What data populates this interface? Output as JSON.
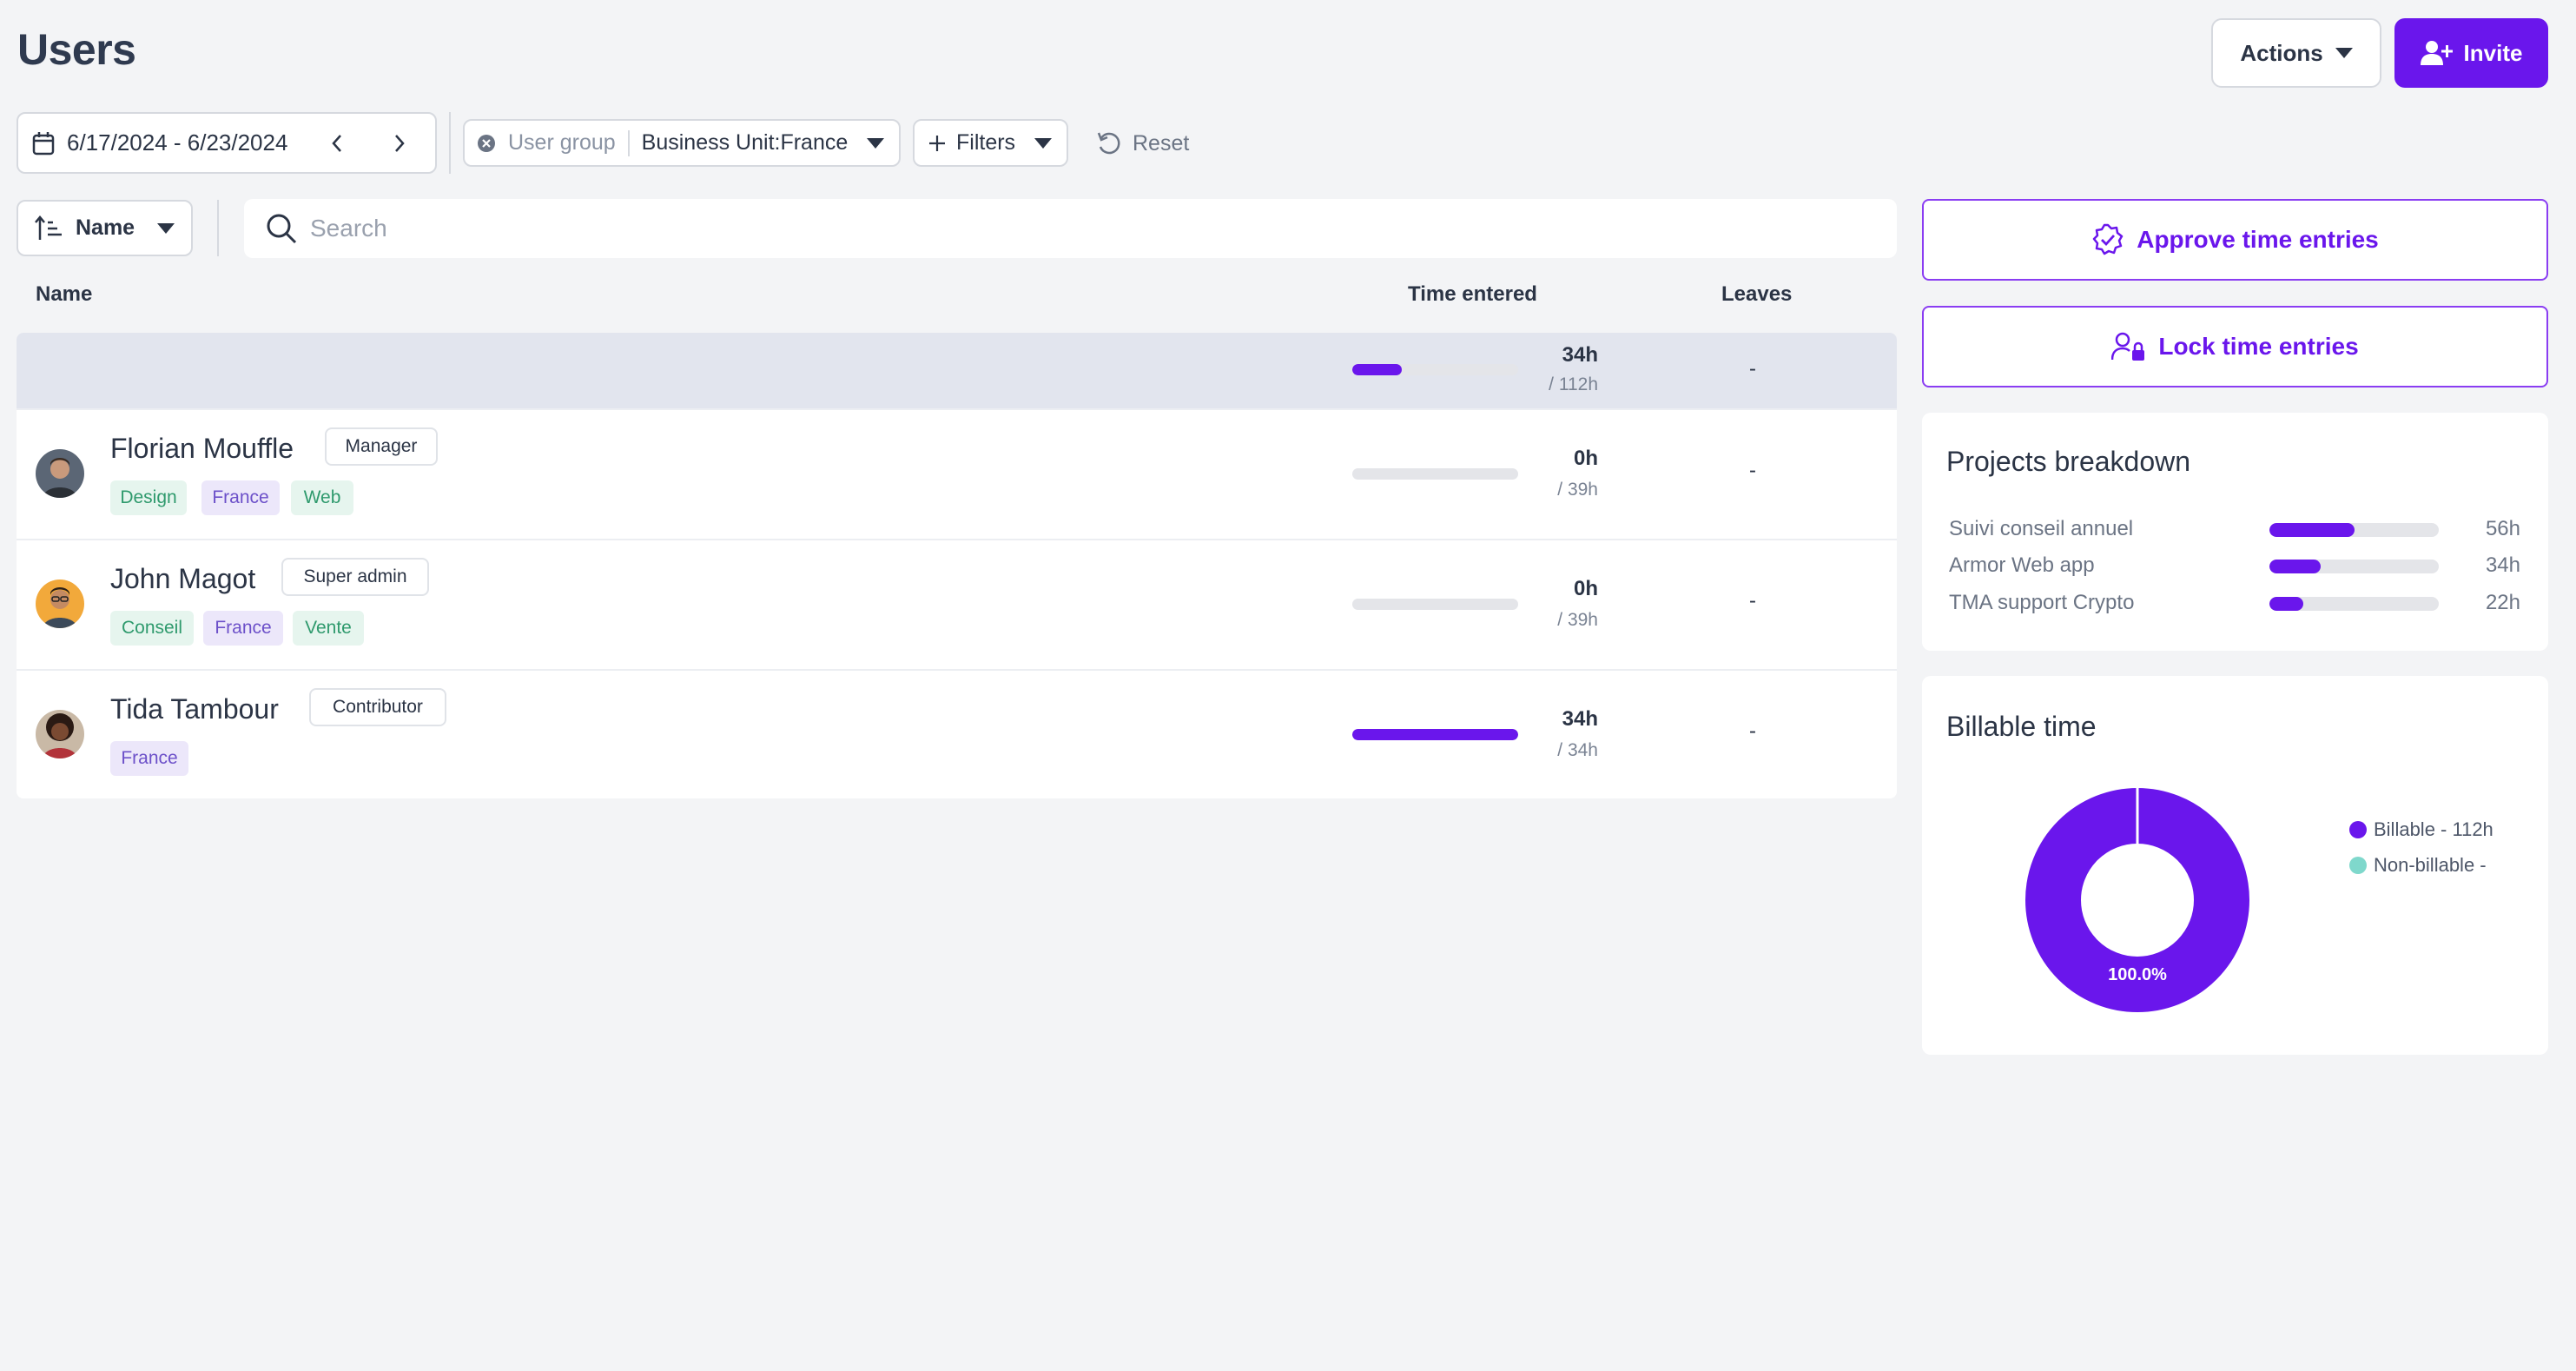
{
  "page": {
    "title": "Users"
  },
  "header": {
    "actions_label": "Actions",
    "invite_label": "Invite"
  },
  "filters": {
    "date_range": "6/17/2024 - 6/23/2024",
    "user_group_label": "User group",
    "user_group_value": "Business Unit:France",
    "filters_label": "Filters",
    "reset_label": "Reset"
  },
  "sort": {
    "label": "Name"
  },
  "search": {
    "placeholder": "Search"
  },
  "table": {
    "columns": {
      "name": "Name",
      "time_entered": "Time entered",
      "leaves": "Leaves"
    },
    "total": {
      "hours": "34h",
      "total": "/ 112h",
      "progress": 0.3,
      "leaves": "-"
    },
    "rows": [
      {
        "name": "Florian Mouffle",
        "role": "Manager",
        "tags": [
          "Design",
          "France",
          "Web"
        ],
        "hours": "0h",
        "total": "/ 39h",
        "progress": 0,
        "leaves": "-"
      },
      {
        "name": "John Magot",
        "role": "Super admin",
        "tags": [
          "Conseil",
          "France",
          "Vente"
        ],
        "hours": "0h",
        "total": "/ 39h",
        "progress": 0,
        "leaves": "-"
      },
      {
        "name": "Tida Tambour",
        "role": "Contributor",
        "tags": [
          "France"
        ],
        "hours": "34h",
        "total": "/ 34h",
        "progress": 1.0,
        "leaves": "-"
      }
    ]
  },
  "side": {
    "approve_label": "Approve time entries",
    "lock_label": "Lock time entries",
    "projects": {
      "title": "Projects breakdown",
      "items": [
        {
          "name": "Suivi conseil annuel",
          "value": "56h",
          "progress": 0.5
        },
        {
          "name": "Armor Web app",
          "value": "34h",
          "progress": 0.3
        },
        {
          "name": "TMA support Crypto",
          "value": "22h",
          "progress": 0.2
        }
      ]
    },
    "billable": {
      "title": "Billable time",
      "center_label": "100.0%",
      "legend": [
        {
          "label": "Billable - 112h",
          "color": "#6a16ec"
        },
        {
          "label": "Non-billable -",
          "color": "#7fd8cc"
        }
      ]
    }
  },
  "colors": {
    "accent": "#6a16ec",
    "tag_green": "#2f9a6d",
    "tag_purple": "#6c50c9"
  }
}
